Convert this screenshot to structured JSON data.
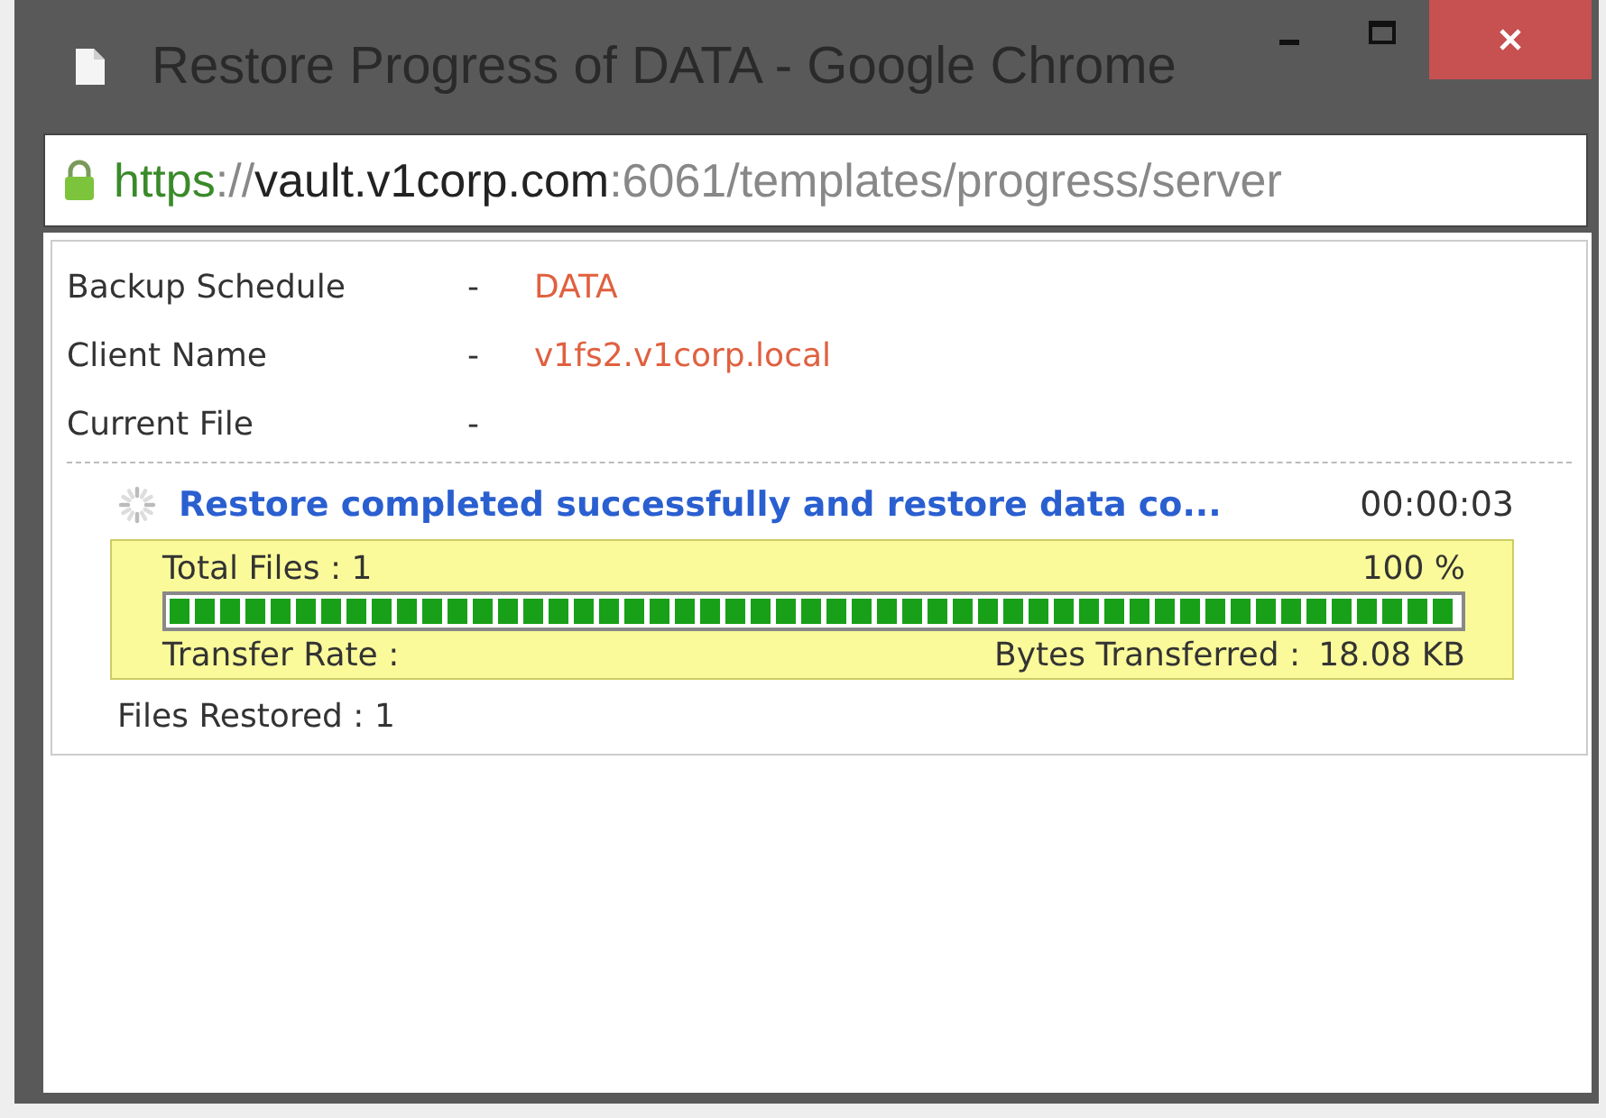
{
  "window": {
    "title": "Restore Progress of DATA - Google Chrome",
    "secure": true
  },
  "address_bar": {
    "scheme": "https",
    "separator": "://",
    "host": "vault.v1corp.com",
    "rest": ":6061/templates/progress/server"
  },
  "details": [
    {
      "label": "Backup Schedule",
      "dash": "-",
      "value": "DATA"
    },
    {
      "label": "Client Name",
      "dash": "-",
      "value": "v1fs2.v1corp.local"
    },
    {
      "label": "Current File",
      "dash": "-"
    }
  ],
  "status": {
    "message": "Restore completed successfully and restore data co...",
    "elapsed": "00:00:03"
  },
  "progress": {
    "total_files": "Total Files : 1",
    "percent": "100 %",
    "level": 1,
    "transfer_rate": "Transfer Rate :",
    "bytes_label": "Bytes Transferred :",
    "bytes_value": "18.08 KB"
  },
  "files_restored": "Files Restored : 1"
}
